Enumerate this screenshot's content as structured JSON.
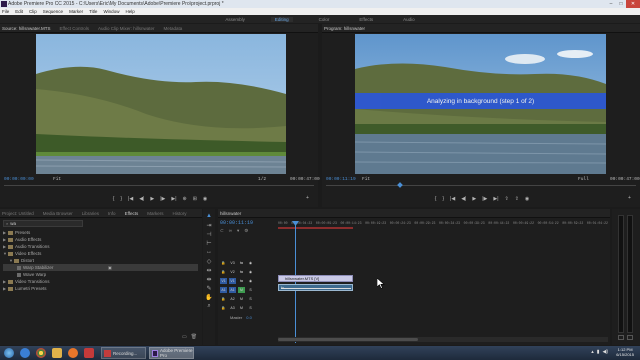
{
  "window": {
    "title": "Adobe Premiere Pro CC 2015 - C:\\Users\\Eric\\My Documents\\Adobe\\Premiere Pro\\project.prproj *"
  },
  "menu": [
    "File",
    "Edit",
    "Clip",
    "Sequence",
    "Marker",
    "Title",
    "Window",
    "Help"
  ],
  "workspaces": [
    {
      "label": "Assembly",
      "active": false
    },
    {
      "label": "Editing",
      "active": true
    },
    {
      "label": "Color",
      "active": false
    },
    {
      "label": "Effects",
      "active": false
    },
    {
      "label": "Audio",
      "active": false
    }
  ],
  "source_monitor": {
    "tabs": [
      "Source: hillsnwater.MTS",
      "Effect Controls",
      "Audio Clip Mixer: hillsnwater",
      "Metadata"
    ],
    "timecode_in": "00:00:00:00",
    "fit": "Fit",
    "quality": "1/2",
    "duration": "00:00:47:00"
  },
  "program_monitor": {
    "tab": "Program: hillsnwater",
    "timecode": "00:00:11:19",
    "fit": "Fit",
    "quality": "Full",
    "duration": "00:00:47:00",
    "overlay_text": "Analyzing in background (step 1 of 2)"
  },
  "project_panel": {
    "tabs": [
      "Project: Untitled",
      "Media Browser",
      "Libraries",
      "Info",
      "Effects",
      "Markers",
      "History"
    ],
    "active_tab": "Effects",
    "search_value": "wa",
    "tree": [
      {
        "label": "Presets",
        "level": 0,
        "expanded": false,
        "selected": false
      },
      {
        "label": "Audio Effects",
        "level": 0,
        "expanded": false,
        "selected": false
      },
      {
        "label": "Audio Transitions",
        "level": 0,
        "expanded": false,
        "selected": false
      },
      {
        "label": "Video Effects",
        "level": 0,
        "expanded": true,
        "selected": false
      },
      {
        "label": "Distort",
        "level": 1,
        "expanded": true,
        "selected": false
      },
      {
        "label": "Warp Stabilizer",
        "level": 2,
        "expanded": false,
        "selected": true
      },
      {
        "label": "Wave Warp",
        "level": 2,
        "expanded": false,
        "selected": false
      },
      {
        "label": "Video Transitions",
        "level": 0,
        "expanded": false,
        "selected": false
      },
      {
        "label": "Lumetri Presets",
        "level": 0,
        "expanded": false,
        "selected": false
      }
    ]
  },
  "timeline": {
    "tab": "hillsnwater",
    "timecode": "00:00:11:19",
    "ruler": [
      "00:00",
      "00:00:04:23",
      "00:00:09:23",
      "00:00:14:23",
      "00:00:19:23",
      "00:00:24:23",
      "00:00:29:23",
      "00:00:34:23",
      "00:00:39:23",
      "00:00:44:22",
      "00:00:49:22",
      "00:00:54:22",
      "00:00:59:22",
      "00:01:04:22"
    ],
    "tracks": [
      "V3",
      "V2",
      "V1",
      "A1",
      "A2",
      "A3"
    ],
    "master_label": "Master",
    "master_value": "0.0",
    "video_clip": "hillsnwater.MTS [V]",
    "audio_clip": "fx"
  },
  "taskbar": {
    "tasks": [
      {
        "label": "Recording...",
        "active": false
      },
      {
        "label": "Adobe Premiere Pro",
        "active": true
      }
    ],
    "time": "1:12 PM",
    "date": "6/15/2015"
  },
  "colors": {
    "accent": "#4a8fd6",
    "overlay_bar": "#2b57d8",
    "clip_video": "#c9c9e6",
    "clip_audio": "#3d6a8f"
  }
}
